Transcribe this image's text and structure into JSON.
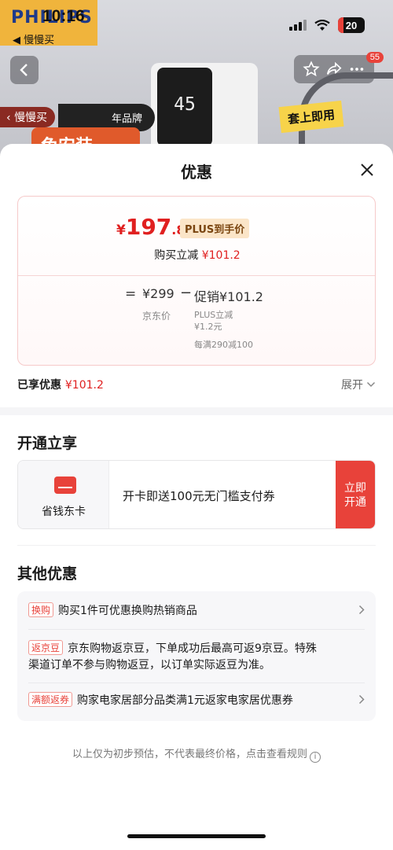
{
  "status_bar": {
    "time": "10:16",
    "back_app": "◀ 慢慢买",
    "battery": "20"
  },
  "background": {
    "brand": "PHILIPS",
    "device_display": "45",
    "tag_left": "慢慢买",
    "tag_brand": "年品牌",
    "tag_install": "套上即用",
    "tag_orange": "免安装",
    "cart_badge": "55"
  },
  "sheet": {
    "title": "优惠",
    "price_card": {
      "currency": "¥",
      "price_int": "197",
      "price_dec": ".8",
      "plus_badge": "PLUS到手价",
      "reduce_label": "购买立减",
      "reduce_value": "¥101.2",
      "formula": {
        "eq": "=",
        "base_value": "¥299",
        "base_label": "京东价",
        "minus": "−",
        "promo_value": "促销¥101.2",
        "promo_sub": [
          "PLUS立减",
          "¥1.2元",
          "每满290减100"
        ]
      }
    },
    "enjoyed": {
      "label": "已享优惠",
      "value": "¥101.2"
    },
    "expand_label": "展开",
    "open_section": {
      "title": "开通立享",
      "card_label": "省钱东卡",
      "card_desc": "开卡即送100元无门槛支付券",
      "button_label": "立即开通"
    },
    "other_section": {
      "title": "其他优惠",
      "offers": [
        {
          "tag": "换购",
          "text": "购买1件可优惠换购热销商品"
        },
        {
          "tag": "返京豆",
          "text_line1": "京东购物返京豆，下单成功后最高可返9京豆。特殊",
          "text_line2": "渠道订单不参与购物返豆，以订单实际返豆为准。"
        },
        {
          "tag": "满额返券",
          "text": "购家电家居部分品类满1元返家电家居优惠券"
        }
      ]
    },
    "disclaimer": "以上仅为初步预估，不代表最终价格，点击查看规则"
  },
  "colors": {
    "accent": "#e8423a",
    "price_red": "#e02020",
    "plus_bg": "#fbe5c8"
  }
}
